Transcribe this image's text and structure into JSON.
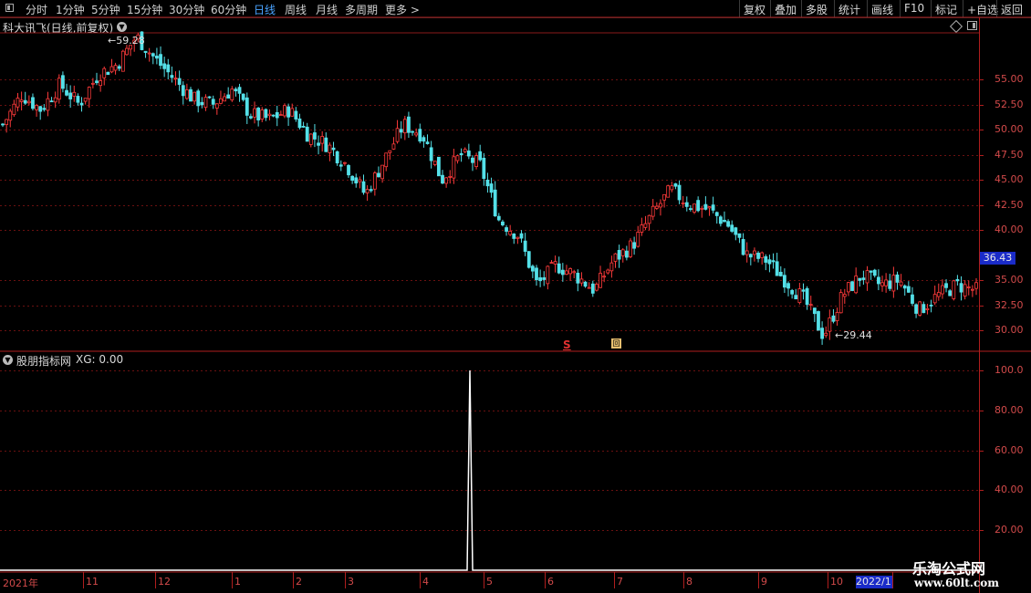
{
  "toolbar": {
    "periods": [
      {
        "label": "分时",
        "active": false
      },
      {
        "label": "1分钟",
        "active": false
      },
      {
        "label": "5分钟",
        "active": false
      },
      {
        "label": "15分钟",
        "active": false
      },
      {
        "label": "30分钟",
        "active": false
      },
      {
        "label": "60分钟",
        "active": false
      },
      {
        "label": "日线",
        "active": true
      },
      {
        "label": "周线",
        "active": false
      },
      {
        "label": "月线",
        "active": false
      },
      {
        "label": "多周期",
        "active": false
      },
      {
        "label": "更多 >",
        "active": false
      }
    ],
    "right_buttons": [
      "复权",
      "叠加",
      "多股",
      "统计",
      "画线",
      "F10",
      "标记",
      "+自选",
      "返回"
    ]
  },
  "main_chart": {
    "title": "科大讯飞(日线,前复权)",
    "high_annotation": "59.28",
    "low_annotation": "29.44",
    "current_price": "36.43",
    "y_ticks": [
      "55.00",
      "52.50",
      "50.00",
      "47.50",
      "45.00",
      "42.50",
      "40.00",
      "35.00",
      "32.50",
      "30.00"
    ],
    "markers": {
      "signal_s": "S",
      "event_icon": "回"
    }
  },
  "indicator": {
    "label": "股朋指标网",
    "value_text": "XG: 0.00",
    "y_ticks": [
      "100.0",
      "80.00",
      "60.00",
      "40.00",
      "20.00"
    ]
  },
  "x_axis": {
    "labels": [
      "2021年",
      "11",
      "12",
      "1",
      "2",
      "3",
      "4",
      "5",
      "6",
      "7",
      "8",
      "9",
      "10"
    ],
    "current_date": "2022/1"
  },
  "watermark": {
    "name": "乐淘公式网",
    "url": "www.60lt.com"
  },
  "chart_data": {
    "type": "candlestick",
    "title": "科大讯飞(日线,前复权)",
    "x_start": "2021年",
    "month_labels": [
      "11",
      "12",
      "1",
      "2",
      "3",
      "4",
      "5",
      "6",
      "7",
      "8",
      "9",
      "10"
    ],
    "ylim": [
      28.0,
      60.5
    ],
    "period_high": 59.28,
    "period_low": 29.44,
    "last_price": 36.43,
    "close_path": [
      50.5,
      53.5,
      52.0,
      54.5,
      52.5,
      55.5,
      56.5,
      59.28,
      57.0,
      55.0,
      53.0,
      52.5,
      54.0,
      51.5,
      51.0,
      52.0,
      49.5,
      48.5,
      46.5,
      43.5,
      47.0,
      50.5,
      49.5,
      45.0,
      47.5,
      46.5,
      41.0,
      39.5,
      34.5,
      36.5,
      35.5,
      34.0,
      37.0,
      38.5,
      41.5,
      44.0,
      42.5,
      42.0,
      40.5,
      37.5,
      37.0,
      35.0,
      33.0,
      29.44,
      33.5,
      35.5,
      34.5,
      35.0,
      32.0,
      33.5,
      34.5,
      34.0
    ],
    "indicator": {
      "name": "XG",
      "ylim": [
        0,
        100
      ],
      "signal_month_fraction": 4.75,
      "signal_value": 100.0,
      "baseline_value": 0.0
    }
  }
}
